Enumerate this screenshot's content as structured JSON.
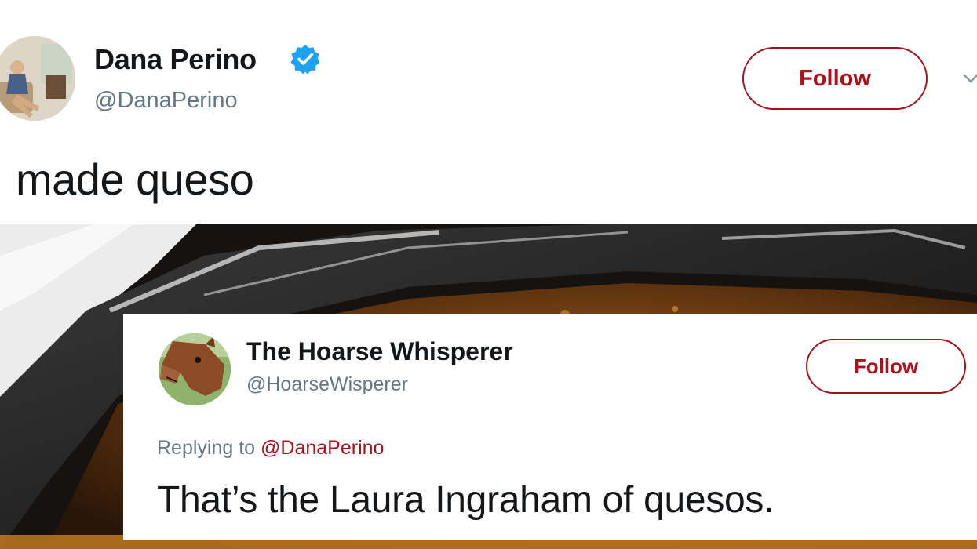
{
  "main_tweet": {
    "display_name": "Dana Perino",
    "handle": "@DanaPerino",
    "follow_label": "Follow",
    "text": "made queso",
    "verified": true,
    "avatar_icon": "profile-photo-woman-seated",
    "verified_icon": "verified-badge-icon",
    "menu_icon": "chevron-down-icon"
  },
  "reply_tweet": {
    "display_name": "The Hoarse Whisperer",
    "handle": "@HoarseWisperer",
    "follow_label": "Follow",
    "replying_prefix": "Replying to",
    "replying_to": "@DanaPerino",
    "text": "That’s the Laura Ingraham of quesos.",
    "avatar_icon": "profile-photo-horse"
  },
  "colors": {
    "follow_text": "#b0101c",
    "follow_border": "#a3131b",
    "secondary_text": "#657786",
    "primary_text": "#14171a",
    "verified_blue": "#1da1f2"
  }
}
